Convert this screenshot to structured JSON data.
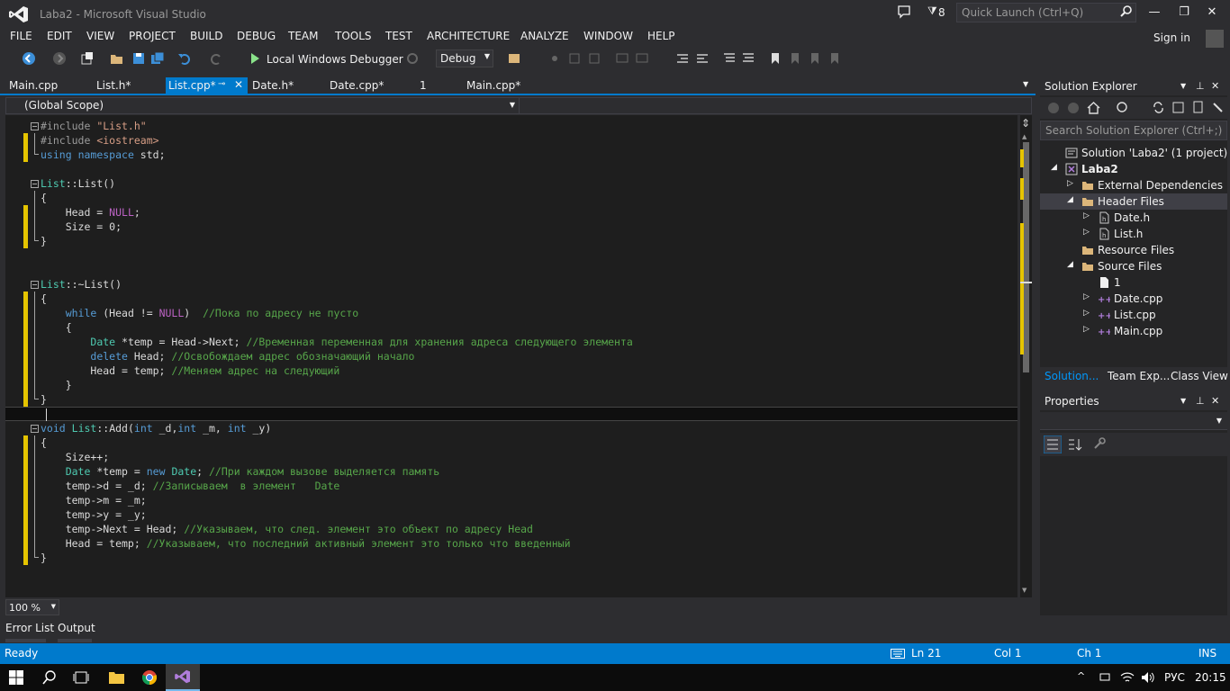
{
  "window": {
    "title": "Laba2 - Microsoft Visual Studio",
    "notification_count": "8",
    "quick_launch_placeholder": "Quick Launch (Ctrl+Q)"
  },
  "menu": {
    "items": [
      "FILE",
      "EDIT",
      "VIEW",
      "PROJECT",
      "BUILD",
      "DEBUG",
      "TEAM",
      "TOOLS",
      "TEST",
      "ARCHITECTURE",
      "ANALYZE",
      "WINDOW",
      "HELP"
    ],
    "sign_in": "Sign in"
  },
  "toolbar": {
    "run_label": "Local Windows Debugger",
    "configuration": "Debug"
  },
  "tabs": [
    {
      "label": "Main.cpp",
      "active": false
    },
    {
      "label": "List.h*",
      "active": false
    },
    {
      "label": "List.cpp*",
      "active": true
    },
    {
      "label": "Date.h*",
      "active": false
    },
    {
      "label": "Date.cpp*",
      "active": false
    },
    {
      "label": "1",
      "active": false
    },
    {
      "label": "Main.cpp*",
      "active": false
    }
  ],
  "scope": "(Global Scope)",
  "editor": {
    "zoom": "100 %",
    "current_line": 21
  },
  "code_lines": [
    [
      [
        "pp",
        "#include "
      ],
      [
        "str",
        "\"List.h\""
      ]
    ],
    [
      [
        "pp",
        "#include "
      ],
      [
        "str",
        "<iostream>"
      ]
    ],
    [
      [
        "kw",
        "using"
      ],
      [
        "pl",
        " "
      ],
      [
        "kw",
        "namespace"
      ],
      [
        "pl",
        " std;"
      ]
    ],
    [],
    [
      [
        "ty",
        "List"
      ],
      [
        "pl",
        "::"
      ],
      [
        "pl",
        "List()"
      ]
    ],
    [
      [
        "pl",
        "{"
      ]
    ],
    [
      [
        "pl",
        "    Head = "
      ],
      [
        "mac",
        "NULL"
      ],
      [
        "pl",
        ";"
      ]
    ],
    [
      [
        "pl",
        "    Size = 0;"
      ]
    ],
    [
      [
        "pl",
        "}"
      ]
    ],
    [],
    [],
    [
      [
        "ty",
        "List"
      ],
      [
        "pl",
        "::~List()"
      ]
    ],
    [
      [
        "pl",
        "{"
      ]
    ],
    [
      [
        "pl",
        "    "
      ],
      [
        "kw",
        "while"
      ],
      [
        "pl",
        " (Head != "
      ],
      [
        "mac",
        "NULL"
      ],
      [
        "pl",
        ")  "
      ],
      [
        "cm",
        "//Пока по адресу не пусто"
      ]
    ],
    [
      [
        "pl",
        "    {"
      ]
    ],
    [
      [
        "pl",
        "        "
      ],
      [
        "ty",
        "Date"
      ],
      [
        "pl",
        " *temp = Head->Next; "
      ],
      [
        "cm",
        "//Временная переменная для хранения адреса следующего элемента"
      ]
    ],
    [
      [
        "pl",
        "        "
      ],
      [
        "kw",
        "delete"
      ],
      [
        "pl",
        " Head; "
      ],
      [
        "cm",
        "//Освобождаем адрес обозначающий начало"
      ]
    ],
    [
      [
        "pl",
        "        Head = temp; "
      ],
      [
        "cm",
        "//Меняем адрес на следующий"
      ]
    ],
    [
      [
        "pl",
        "    }"
      ]
    ],
    [
      [
        "pl",
        "}"
      ]
    ],
    [],
    [
      [
        "kw",
        "void"
      ],
      [
        "pl",
        " "
      ],
      [
        "ty",
        "List"
      ],
      [
        "pl",
        "::Add("
      ],
      [
        "kw",
        "int"
      ],
      [
        "pl",
        " _d,"
      ],
      [
        "kw",
        "int"
      ],
      [
        "pl",
        " _m, "
      ],
      [
        "kw",
        "int"
      ],
      [
        "pl",
        " _y)"
      ]
    ],
    [
      [
        "pl",
        "{"
      ]
    ],
    [
      [
        "pl",
        "    Size++;"
      ]
    ],
    [
      [
        "pl",
        "    "
      ],
      [
        "ty",
        "Date"
      ],
      [
        "pl",
        " *temp = "
      ],
      [
        "kw",
        "new"
      ],
      [
        "pl",
        " "
      ],
      [
        "ty",
        "Date"
      ],
      [
        "pl",
        "; "
      ],
      [
        "cm",
        "//При каждом вызове выделяется память"
      ]
    ],
    [
      [
        "pl",
        "    temp->d = _d; "
      ],
      [
        "cm",
        "//Записываем  в элемент   Date"
      ]
    ],
    [
      [
        "pl",
        "    temp->m = _m;"
      ]
    ],
    [
      [
        "pl",
        "    temp->y = _y;"
      ]
    ],
    [
      [
        "pl",
        "    temp->Next = Head; "
      ],
      [
        "cm",
        "//Указываем, что след. элемент это объект по адресу Head"
      ]
    ],
    [
      [
        "pl",
        "    Head = temp; "
      ],
      [
        "cm",
        "//Указываем, что последний активный элемент это только что введенный"
      ]
    ],
    [
      [
        "pl",
        "}"
      ]
    ]
  ],
  "bottom_tabs": [
    "Error List",
    "Output"
  ],
  "solution_explorer": {
    "title": "Solution Explorer",
    "search_placeholder": "Search Solution Explorer (Ctrl+;)",
    "nodes": [
      {
        "label": "Solution 'Laba2' (1 project)",
        "icon": "solution-icon",
        "expander": ""
      },
      {
        "label": "Laba2",
        "icon": "project-icon",
        "expander": "expanded",
        "bold": true
      },
      {
        "label": "External Dependencies",
        "icon": "folder-icon",
        "expander": "collapsed"
      },
      {
        "label": "Header Files",
        "icon": "folder-icon",
        "expander": "expanded",
        "selected": true
      },
      {
        "label": "Date.h",
        "icon": "header-file-icon",
        "expander": "collapsed"
      },
      {
        "label": "List.h",
        "icon": "header-file-icon",
        "expander": "collapsed"
      },
      {
        "label": "Resource Files",
        "icon": "folder-icon",
        "expander": ""
      },
      {
        "label": "Source Files",
        "icon": "folder-icon",
        "expander": "expanded"
      },
      {
        "label": "1",
        "icon": "file-icon",
        "expander": ""
      },
      {
        "label": "Date.cpp",
        "icon": "cpp-file-icon",
        "expander": "collapsed"
      },
      {
        "label": "List.cpp",
        "icon": "cpp-file-icon",
        "expander": "collapsed"
      },
      {
        "label": "Main.cpp",
        "icon": "cpp-file-icon",
        "expander": "collapsed"
      }
    ],
    "tabs": [
      "Solution...",
      "Team Exp...",
      "Class View"
    ]
  },
  "properties": {
    "title": "Properties"
  },
  "status": {
    "ready": "Ready",
    "line": "Ln 21",
    "col": "Col 1",
    "ch": "Ch 1",
    "mode": "INS"
  },
  "taskbar": {
    "language": "РУС",
    "clock": "20:15"
  },
  "colors": {
    "accent": "#007acc",
    "editor_bg": "#1e1e1e",
    "change_marker": "#e5c400"
  }
}
